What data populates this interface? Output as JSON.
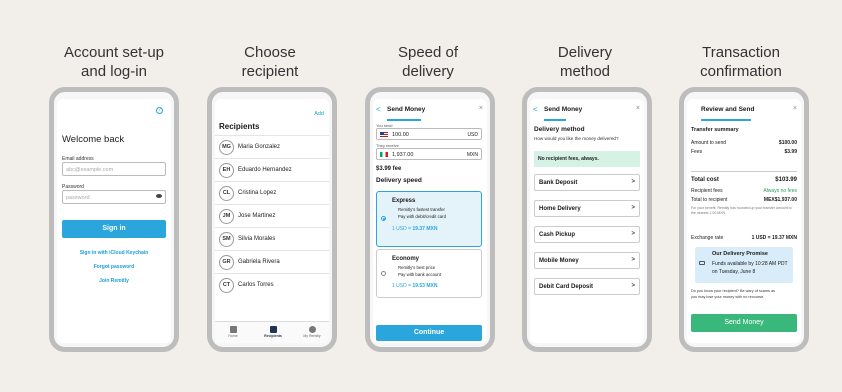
{
  "steps": [
    {
      "title_line1": "Account set-up",
      "title_line2": "and log-in"
    },
    {
      "title_line1": "Choose",
      "title_line2": "recipient"
    },
    {
      "title_line1": "Speed of",
      "title_line2": "delivery"
    },
    {
      "title_line1": "Delivery",
      "title_line2": "method"
    },
    {
      "title_line1": "Transaction",
      "title_line2": "confirmation"
    }
  ],
  "login": {
    "help_icon": "?",
    "heading": "Welcome back",
    "email_label": "Email address",
    "email_placeholder": "abc@example.com",
    "password_label": "Password",
    "password_placeholder": "password",
    "sign_in": "Sign in",
    "icloud": "Sign in with iCloud Keychain",
    "forgot": "Forgot password",
    "join": "Join Remitly"
  },
  "recipients": {
    "add": "Add",
    "title": "Recipients",
    "list": [
      {
        "initials": "MG",
        "name": "Maria Gonzalez"
      },
      {
        "initials": "EH",
        "name": "Eduardo Hernandez"
      },
      {
        "initials": "CL",
        "name": "Cristina Lopez"
      },
      {
        "initials": "JM",
        "name": "Jose Martinez"
      },
      {
        "initials": "SM",
        "name": "Silvia Morales"
      },
      {
        "initials": "GR",
        "name": "Gabriela Rivera"
      },
      {
        "initials": "CT",
        "name": "Carlos Torres"
      }
    ],
    "tabs": [
      "Home",
      "Recipients",
      "My Remitly"
    ]
  },
  "speed": {
    "back": "<",
    "title": "Send Money",
    "close": "×",
    "you_send_label": "You send",
    "you_send_value": "100.00",
    "you_send_currency": "USD",
    "they_receive_label": "They receive",
    "they_receive_value": "1,937.00",
    "they_receive_currency": "MXN",
    "fee": "$3.99 fee",
    "section": "Delivery speed",
    "express": {
      "name": "Express",
      "line1": "Remitly's fastest transfer",
      "line2": "Pay with debit/credit card",
      "rate_prefix": "1 USD = ",
      "rate": "19.37 MXN"
    },
    "economy": {
      "name": "Economy",
      "line1": "Remitly's best price",
      "line2": "Pay with bank account",
      "rate_prefix": "1 USD = ",
      "rate": "19.53 MXN"
    },
    "continue": "Continue"
  },
  "method": {
    "back": "<",
    "title": "Send Money",
    "close": "×",
    "section": "Delivery method",
    "question": "How would you like the money delivered?",
    "banner": "No recipient fees, always.",
    "options": [
      "Bank Deposit",
      "Home Delivery",
      "Cash Pickup",
      "Mobile Money",
      "Debit Card Deposit"
    ],
    "chevron": ">"
  },
  "confirm": {
    "title": "Review and Send",
    "close": "×",
    "summary": "Transfer summary",
    "amount_label": "Amount to send",
    "amount": "$100.00",
    "fees_label": "Fees",
    "fees": "$3.99",
    "total_label": "Total cost",
    "total": "$103.99",
    "recipient_fees_label": "Recipient fees",
    "recipient_fees": "Always no fees",
    "total_recipient_label": "Total to recipient",
    "total_recipient": "MEX$1,937.00",
    "note": "For your benefit, Remitly has rounded up your transfer amount to the nearest 1.00 MXN.",
    "exchange_label": "Exchange rate",
    "exchange": "1 USD = 19.37 MXN",
    "promise_title": "Our Delivery Promise",
    "promise_text1": "Funds available by 10:28 AM PDT",
    "promise_text2": "on Tuesday, June 8",
    "scam1": "Do you know your recipient? Be wary of scams as",
    "scam2": "you may lose your money with no recourse.",
    "send": "Send Money"
  },
  "colors": {
    "accent": "#2aa6dc",
    "green": "#3ab77a",
    "background": "#f2eee9"
  }
}
